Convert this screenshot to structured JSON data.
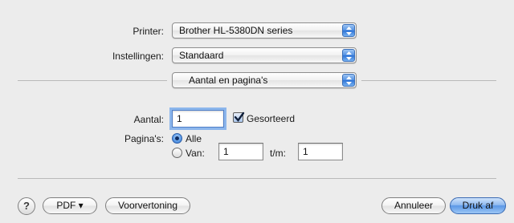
{
  "printer": {
    "label": "Printer:",
    "value": "Brother HL-5380DN series"
  },
  "settings": {
    "label": "Instellingen:",
    "value": "Standaard"
  },
  "panel": {
    "value": "Aantal en pagina's"
  },
  "copies": {
    "label": "Aantal:",
    "value": "1",
    "collate_label": "Gesorteerd",
    "collate_checked": true
  },
  "pages": {
    "label": "Pagina's:",
    "all_label": "Alle",
    "from_label": "Van:",
    "from_value": "1",
    "to_label": "t/m:",
    "to_value": "1",
    "selected": "all"
  },
  "footer": {
    "help": "?",
    "pdf_label": "PDF ▾",
    "preview_label": "Voorvertoning",
    "cancel_label": "Annuleer",
    "print_label": "Druk af"
  },
  "colors": {
    "background": "#ececec",
    "accent": "#5b97e6"
  }
}
